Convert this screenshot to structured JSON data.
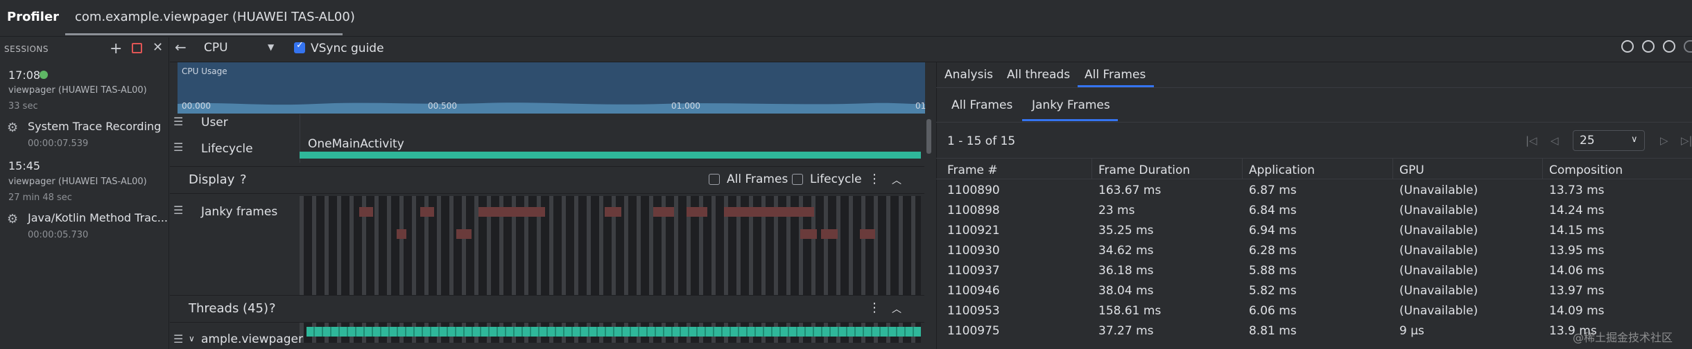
{
  "app": {
    "title": "Profiler",
    "session_tab": "com.example.viewpager (HUAWEI TAS-AL00)"
  },
  "sidebar": {
    "header": "SESSIONS",
    "sessions": [
      {
        "time": "17:08",
        "device": "viewpager (HUAWEI TAS-AL00)",
        "duration": "33 sec"
      },
      {
        "time": "15:45",
        "device": "viewpager (HUAWEI TAS-AL00)",
        "duration": "27 min 48 sec"
      }
    ],
    "recordings": [
      {
        "label": "System Trace Recording",
        "duration": "00:00:07.539"
      },
      {
        "label": "Java/Kotlin Method Trac...",
        "duration": "00:00:05.730"
      }
    ]
  },
  "toolbar": {
    "cpu_select": "CPU",
    "vsync_label": "VSync guide"
  },
  "cpu_panel": {
    "label": "CPU Usage",
    "ticks": [
      "00.000",
      "00.500",
      "01.000",
      "01"
    ]
  },
  "tracks": {
    "user": "User",
    "lifecycle": "Lifecycle",
    "activity": "OneMainActivity",
    "display": "Display",
    "display_help": "?",
    "all_frames_chk": "All Frames",
    "lifecycle_chk": "Lifecycle",
    "janky": "Janky frames",
    "threads": "Threads (45)",
    "threads_help": "?",
    "thread0": "ample.viewpager"
  },
  "right": {
    "tabs": [
      "Analysis",
      "All threads",
      "All Frames"
    ],
    "subtabs": [
      "All Frames",
      "Janky Frames"
    ],
    "range": "1 - 15 of 15",
    "page_size": "25",
    "columns": [
      "Frame #",
      "Frame Duration",
      "Application",
      "GPU",
      "Composition"
    ],
    "rows": [
      [
        "1100890",
        "163.67 ms",
        "6.87 ms",
        "(Unavailable)",
        "13.73 ms"
      ],
      [
        "1100898",
        "23 ms",
        "6.84 ms",
        "(Unavailable)",
        "14.24 ms"
      ],
      [
        "1100921",
        "35.25 ms",
        "6.94 ms",
        "(Unavailable)",
        "14.15 ms"
      ],
      [
        "1100930",
        "34.62 ms",
        "6.28 ms",
        "(Unavailable)",
        "13.95 ms"
      ],
      [
        "1100937",
        "36.18 ms",
        "5.88 ms",
        "(Unavailable)",
        "14.06 ms"
      ],
      [
        "1100946",
        "38.04 ms",
        "5.82 ms",
        "(Unavailable)",
        "13.97 ms"
      ],
      [
        "1100953",
        "158.61 ms",
        "6.06 ms",
        "(Unavailable)",
        "14.09 ms"
      ],
      [
        "1100975",
        "37.27 ms",
        "8.81 ms",
        "9 µs",
        "13.9 ms"
      ]
    ]
  },
  "watermark": "@稀土掘金技术社区",
  "colors": {
    "accent": "#3574f0",
    "teal": "#2fb79a",
    "jank": "#6a3b3b",
    "cpu_bg": "#2f4e6e"
  }
}
